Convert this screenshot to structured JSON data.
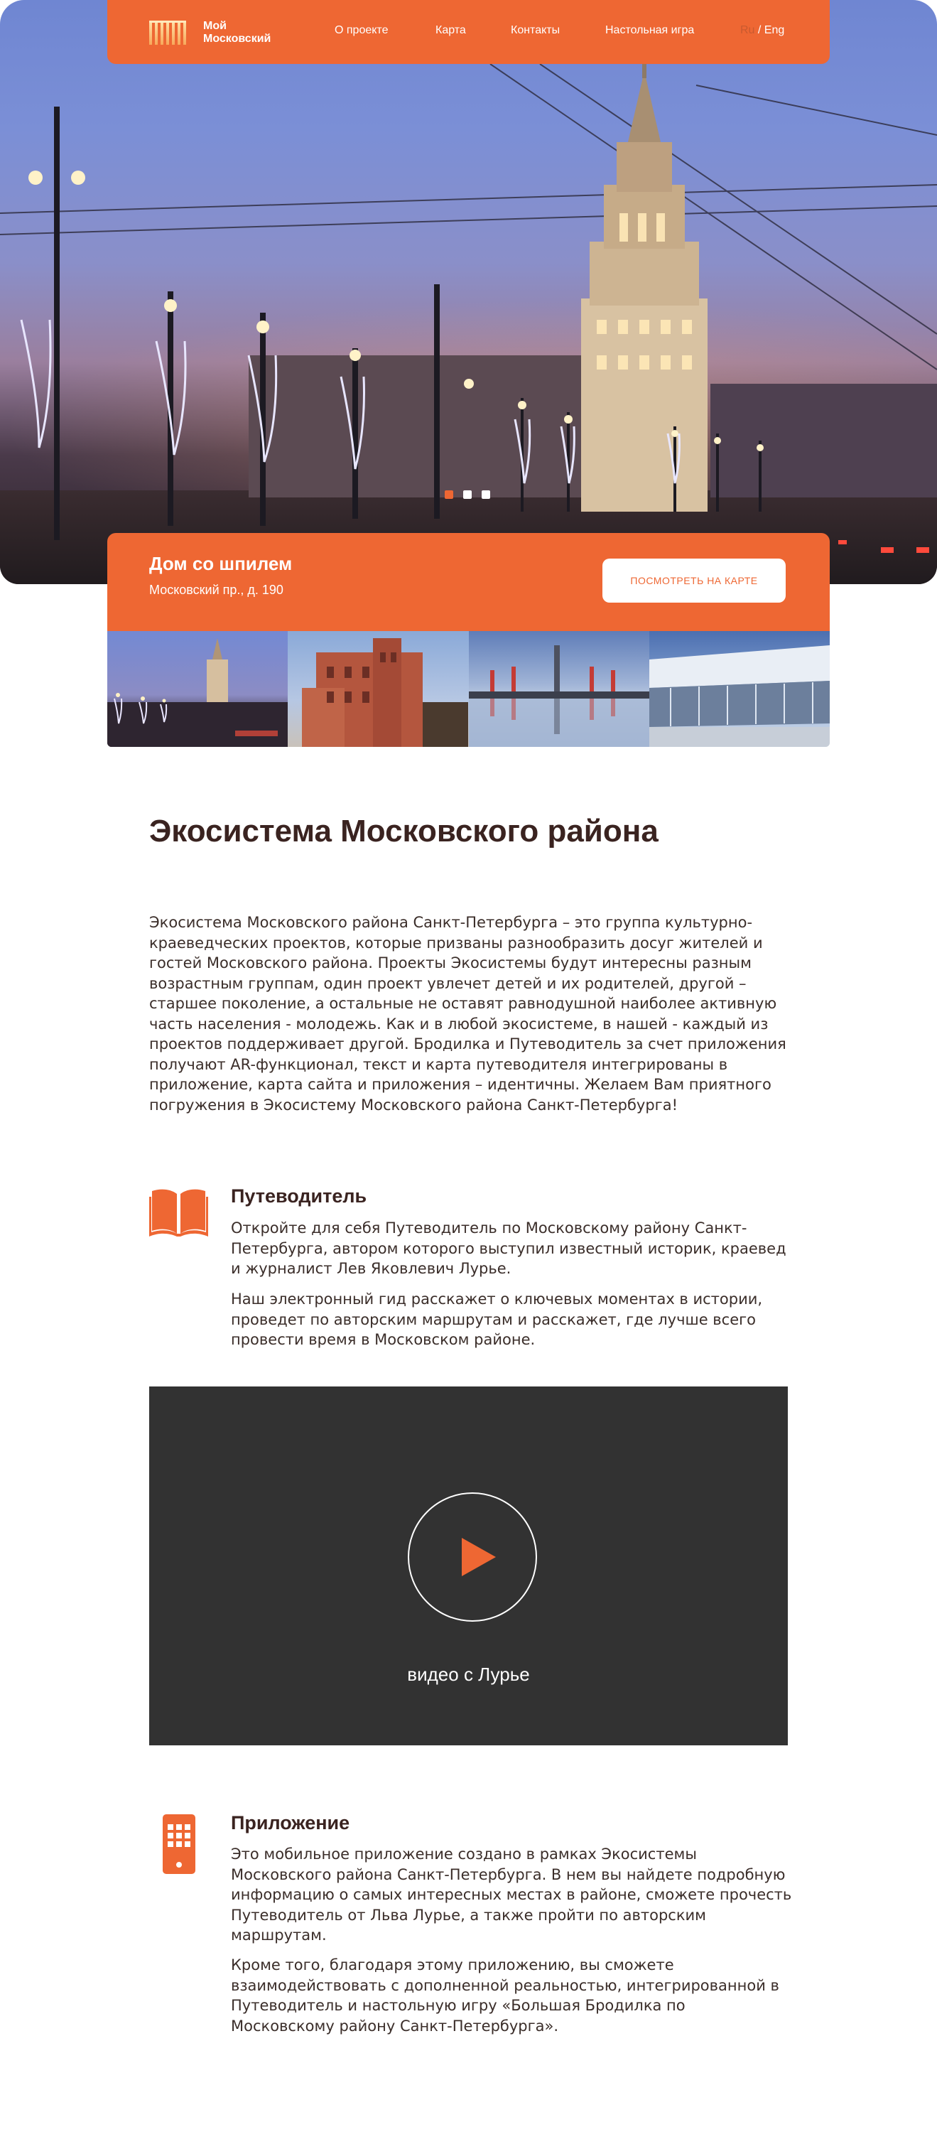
{
  "brand": {
    "line1": "Мой",
    "line2": "Московский"
  },
  "nav": {
    "items": [
      {
        "label": "О проекте"
      },
      {
        "label": "Карта"
      },
      {
        "label": "Контакты"
      },
      {
        "label": "Настольная игра"
      }
    ],
    "lang_ru": "Ru",
    "lang_sep": " / ",
    "lang_en": "Eng"
  },
  "slider": {
    "slides_total": 3,
    "active_slide": 1
  },
  "feature_place": {
    "title": "Дом со шпилем",
    "address": "Московский пр., д. 190",
    "map_button": "ПОСМОТРЕТЬ НА КАРТЕ"
  },
  "main": {
    "title": "Экосистема Московского района",
    "intro": "Экосистема Московского района Санкт-Петербурга – это группа культурно-краеведческих проектов, которые призваны разнообразить досуг жителей и гостей Московского района. Проекты Экосистемы будут интересны разным возрастным группам, один проект увлечет детей и их родителей, другой – старшее поколение, а остальные не оставят равнодушной наиболее активную часть населения - молодежь. Как и в любой экосистеме, в нашей - каждый из проектов поддерживает другой. Бродилка и Путеводитель за счет приложения получают AR-функционал, текст и карта путеводителя интегрированы в приложение, карта сайта и приложения – идентичны. Желаем Вам приятного погружения в Экосистему Московского района Санкт-Петербурга!"
  },
  "guide": {
    "icon": "book-icon",
    "title": "Путеводитель",
    "p1": "Откройте для себя Путеводитель по Московскому району Санкт-Петербурга, автором которого выступил известный историк, краевед и журналист Лев Яковлевич Лурье.",
    "p2": "Наш электронный гид расскажет о ключевых моментах в истории, проведет по авторским маршрутам и расскажет, где лучше всего провести время в Московском районе."
  },
  "video": {
    "caption": "видео с Лурье"
  },
  "app": {
    "icon": "smartphone-icon",
    "title": "Приложение",
    "p1": "Это мобильное приложение создано в рамках Экосистемы Московского района Санкт-Петербурга. В нем вы найдете подробную информацию о самых интересных местах в районе, сможете прочесть Путеводитель от Льва Лурье, а также пройти по авторским маршрутам.",
    "p2": "Кроме того, благодаря этому приложению, вы сможете взаимодействовать с дополненной реальностью, интегрированной в Путеводитель и настольную игру «Большая Бродилка по Московскому району Санкт-Петербурга»."
  },
  "colors": {
    "accent": "#ee6733",
    "dark_text": "#3a2320",
    "video_bg": "#323232"
  }
}
